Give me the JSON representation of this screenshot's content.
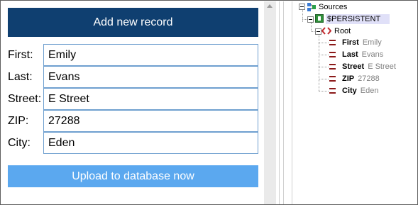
{
  "form": {
    "add_button_label": "Add new record",
    "fields": [
      {
        "label": "First:",
        "value": "Emily"
      },
      {
        "label": "Last:",
        "value": "Evans"
      },
      {
        "label": "Street:",
        "value": "E Street"
      },
      {
        "label": "ZIP:",
        "value": "27288"
      },
      {
        "label": "City:",
        "value": "Eden"
      }
    ],
    "upload_button_label": "Upload to database now"
  },
  "tree": {
    "sources_label": "Sources",
    "persistent_label": "$PERSISTENT",
    "root_label": "Root",
    "leaves": [
      {
        "name": "First",
        "value": "Emily"
      },
      {
        "name": "Last",
        "value": "Evans"
      },
      {
        "name": "Street",
        "value": "E Street"
      },
      {
        "name": "ZIP",
        "value": "27288"
      },
      {
        "name": "City",
        "value": "Eden"
      }
    ]
  },
  "colors": {
    "primary_button": "#0f3f70",
    "secondary_button": "#5ba8ef",
    "input_border": "#6e9fcf",
    "selection_highlight": "#e0e0f8",
    "leaf_icon": "#8b1a1a",
    "element_icon": "#c0282d"
  },
  "icons": {
    "sources": "sources-icon",
    "persistent": "persistent-tree-icon",
    "root": "xml-element-icon",
    "leaf": "attribute-icon"
  }
}
